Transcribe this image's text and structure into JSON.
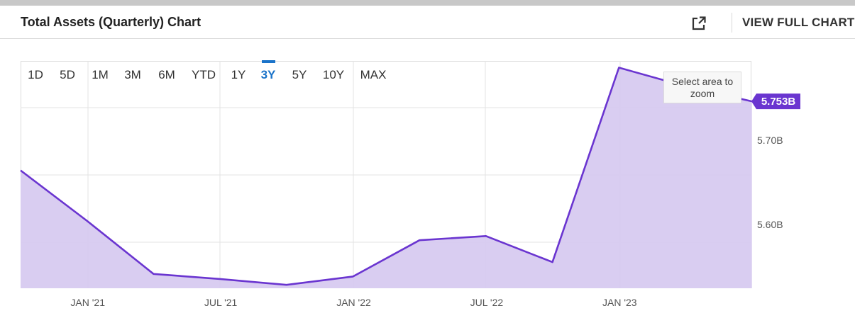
{
  "header": {
    "title": "Total Assets (Quarterly) Chart",
    "full_chart_label": "VIEW FULL CHART",
    "external_icon": "external-link-icon"
  },
  "range_buttons": [
    "1D",
    "5D",
    "1M",
    "3M",
    "6M",
    "YTD",
    "1Y",
    "3Y",
    "5Y",
    "10Y",
    "MAX"
  ],
  "active_range": "3Y",
  "zoom_hint": "Select area to zoom",
  "colors": {
    "line": "#6a35d0",
    "fill": "#d7caf0",
    "accent": "#1a73c9",
    "badge": "#6a35d0"
  },
  "chart_data": {
    "type": "area",
    "title": "Total Assets (Quarterly) Chart",
    "x": [
      "Oct '20",
      "Jan '21",
      "Apr '21",
      "Jul '21",
      "Oct '21",
      "Jan '22",
      "Apr '22",
      "Jul '22",
      "Oct '22",
      "Jan '23",
      "Apr '23",
      "Jul '23"
    ],
    "values": [
      5.671,
      5.611,
      5.548,
      5.542,
      5.535,
      5.545,
      5.588,
      5.593,
      5.562,
      5.793,
      5.771,
      5.753
    ],
    "x_tick_labels": [
      "JAN '21",
      "JUL '21",
      "JAN '22",
      "JUL '22",
      "JAN '23"
    ],
    "y_tick_labels": [
      "5.60B",
      "5.70B"
    ],
    "y_ticks": [
      5.6,
      5.7
    ],
    "ylim": [
      5.531,
      5.801
    ],
    "last_value_label": "5.753B",
    "grid": true,
    "y_axis_position": "right"
  }
}
